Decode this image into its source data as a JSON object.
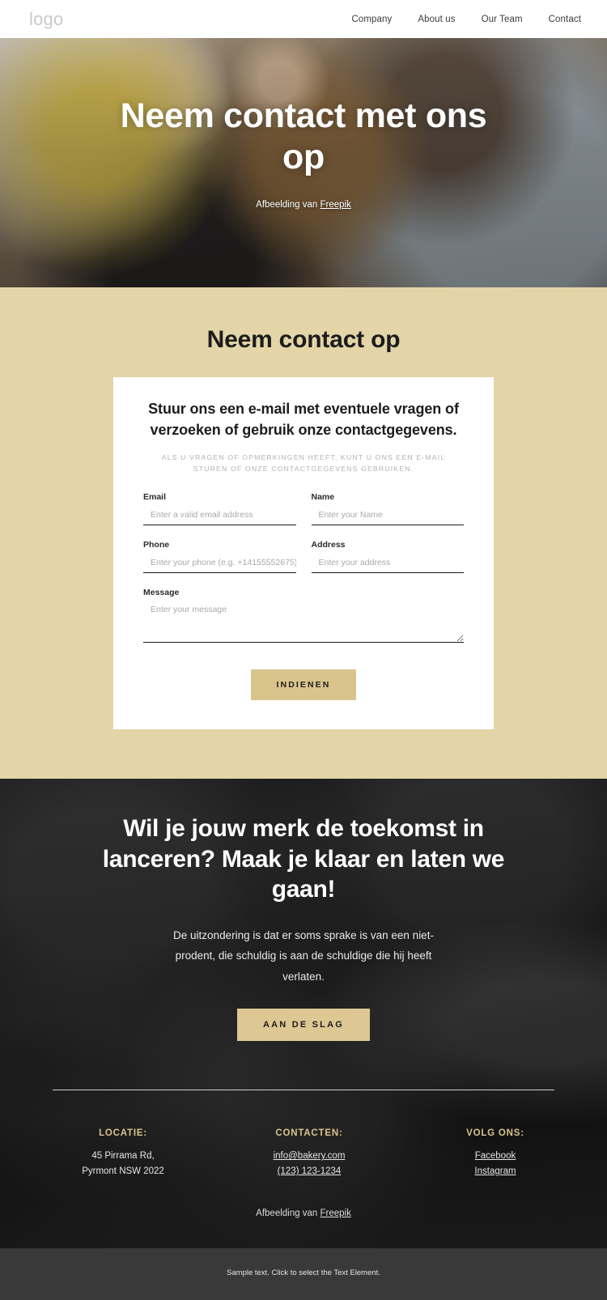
{
  "header": {
    "logo": "logo",
    "nav": [
      {
        "label": "Company"
      },
      {
        "label": "About us"
      },
      {
        "label": "Our Team"
      },
      {
        "label": "Contact"
      }
    ]
  },
  "hero": {
    "title": "Neem contact met ons op",
    "credit_prefix": "Afbeelding van ",
    "credit_link": "Freepik"
  },
  "contact": {
    "section_title": "Neem contact op",
    "card_heading": "Stuur ons een e-mail met eventuele vragen of verzoeken\nof gebruik onze contactgegevens.",
    "card_subtitle": "ALS U VRAGEN OF OPMERKINGEN HEEFT, KUNT U ONS EEN E-MAIL STUREN OF ONZE CONTACTGEGEVENS GEBRUIKEN.",
    "fields": {
      "email": {
        "label": "Email",
        "placeholder": "Enter a valid email address",
        "value": ""
      },
      "name": {
        "label": "Name",
        "placeholder": "Enter your Name",
        "value": ""
      },
      "phone": {
        "label": "Phone",
        "placeholder": "Enter your phone (e.g. +14155552675)",
        "value": ""
      },
      "address": {
        "label": "Address",
        "placeholder": "Enter your address",
        "value": ""
      },
      "message": {
        "label": "Message",
        "placeholder": "Enter your message",
        "value": ""
      }
    },
    "submit_label": "INDIENEN",
    "accent_color": "#d9c48c",
    "background_color": "#e4d5a8"
  },
  "cta": {
    "title": "Wil je jouw merk de toekomst in lanceren? Maak je klaar en laten we gaan!",
    "text": "De uitzondering is dat er soms sprake is van een niet-prodent, die schuldig is aan de schuldige die hij heeft verlaten.",
    "button_label": "AAN DE SLAG",
    "accent_color": "#ddc894"
  },
  "footer": {
    "columns": [
      {
        "title": "LOCATIE:",
        "lines": [
          "45 Pirrama Rd,",
          "Pyrmont NSW 2022"
        ],
        "linked": false
      },
      {
        "title": "CONTACTEN:",
        "lines": [
          "info@bakery.com",
          "(123) 123-1234"
        ],
        "linked": true
      },
      {
        "title": "VOLG ONS:",
        "lines": [
          "Facebook",
          "Instagram"
        ],
        "linked": true
      }
    ],
    "credit_prefix": "Afbeelding van ",
    "credit_link": "Freepik",
    "title_color": "#d9c48c"
  },
  "bottom_bar": {
    "text": "Sample text. Click to select the Text Element."
  }
}
